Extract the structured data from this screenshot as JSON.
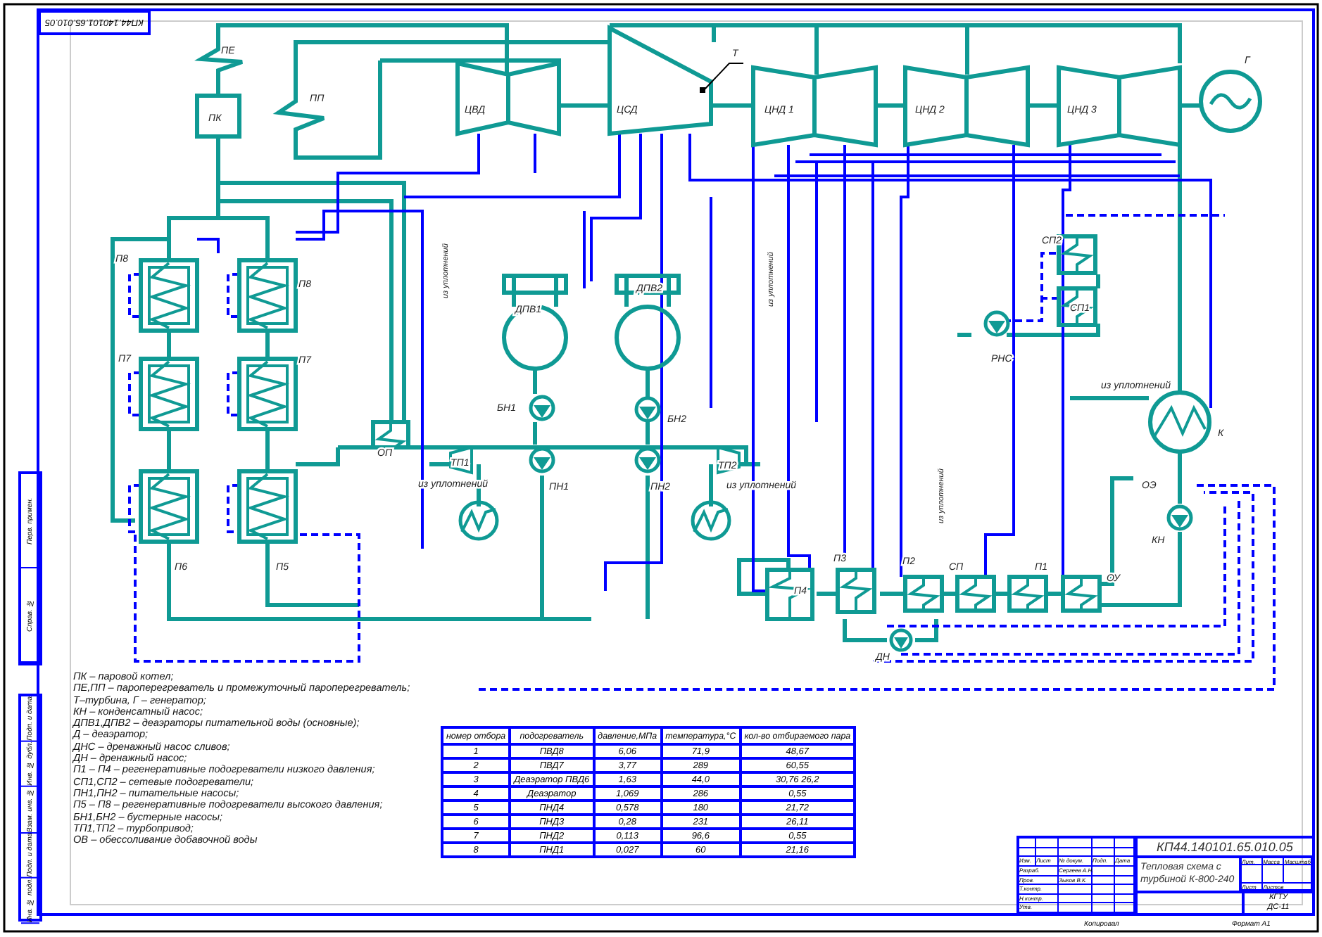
{
  "sheet": {
    "stamp_top": "КП44.140101.65.010.05",
    "side_stamp": [
      "Перв. примен.",
      "Справ. №",
      "Подп. и дата",
      "Инв. № дубл.",
      "Взам. инв. №",
      "Подп. и дата",
      "Инв. № подл."
    ]
  },
  "diagram": {
    "labels": [
      {
        "text": "ПЕ",
        "kind": "horizontal"
      },
      {
        "text": "ПП",
        "kind": "horizontal"
      },
      {
        "text": "ПК",
        "kind": "horizontal"
      },
      {
        "text": "ЦВД",
        "kind": "horizontal"
      },
      {
        "text": "ЦСД",
        "kind": "horizontal"
      },
      {
        "text": "Т",
        "kind": "horizontal"
      },
      {
        "text": "ЦНД 1",
        "kind": "horizontal"
      },
      {
        "text": "ЦНД 2",
        "kind": "horizontal"
      },
      {
        "text": "ЦНД 3",
        "kind": "horizontal"
      },
      {
        "text": "Г",
        "kind": "horizontal"
      },
      {
        "text": "П8",
        "kind": "horizontal"
      },
      {
        "text": "П8",
        "kind": "horizontal"
      },
      {
        "text": "П7",
        "kind": "horizontal"
      },
      {
        "text": "П7",
        "kind": "horizontal"
      },
      {
        "text": "ОП",
        "kind": "horizontal"
      },
      {
        "text": "П6",
        "kind": "horizontal"
      },
      {
        "text": "П5",
        "kind": "horizontal"
      },
      {
        "text": "ДПВ1",
        "kind": "horizontal"
      },
      {
        "text": "ДПВ2",
        "kind": "horizontal"
      },
      {
        "text": "БН1",
        "kind": "horizontal"
      },
      {
        "text": "БН2",
        "kind": "horizontal"
      },
      {
        "text": "ТП1",
        "kind": "horizontal"
      },
      {
        "text": "ТП2",
        "kind": "horizontal"
      },
      {
        "text": "ПН1",
        "kind": "horizontal"
      },
      {
        "text": "ПН2",
        "kind": "horizontal"
      },
      {
        "text": "СП2",
        "kind": "horizontal"
      },
      {
        "text": "СП1",
        "kind": "horizontal"
      },
      {
        "text": "РНС",
        "kind": "horizontal"
      },
      {
        "text": "К",
        "kind": "horizontal"
      },
      {
        "text": "ОЭ",
        "kind": "horizontal"
      },
      {
        "text": "КН",
        "kind": "horizontal"
      },
      {
        "text": "П4",
        "kind": "horizontal"
      },
      {
        "text": "П3",
        "kind": "horizontal"
      },
      {
        "text": "П2",
        "kind": "horizontal"
      },
      {
        "text": "СП",
        "kind": "horizontal"
      },
      {
        "text": "П1",
        "kind": "horizontal"
      },
      {
        "text": "ОУ",
        "kind": "horizontal"
      },
      {
        "text": "ДН",
        "kind": "horizontal"
      },
      {
        "text": "из уплотнений",
        "kind": "vertical"
      },
      {
        "text": "из уплотнений",
        "kind": "vertical"
      },
      {
        "text": "из уплотнений",
        "kind": "vertical"
      },
      {
        "text": "из уплотнений",
        "kind": "horizontal"
      },
      {
        "text": "из уплотнений",
        "kind": "horizontal"
      },
      {
        "text": "из уплотнений",
        "kind": "horizontal"
      }
    ]
  },
  "legend": [
    "ПК – паровой котел;",
    "ПЕ,ПП – пароперегреватель и промежуточный пароперегреватель;",
    "Т–турбина, Г – генератор;",
    "КН – конденсатный насос;",
    "ДПВ1,ДПВ2 – деаэраторы питательной воды (основные);",
    "Д – деаэратор;",
    "ДНС – дренажный насос сливов;",
    "ДН – дренажный насос;",
    "П1 – П4 – регенеративные подогреватели низкого давления;",
    "СП1,СП2 – сетевые подогреватели;",
    "ПН1,ПН2 – питательные насосы;",
    "П5 – П8 – регенеративные подогреватели высокого давления;",
    "БН1,БН2 – бустерные насосы;",
    "ТП1,ТП2 – турбопривод;",
    "ОВ – обессоливание добавочной воды"
  ],
  "table": {
    "columns": [
      "номер отбора",
      "подогреватель",
      "давление,МПа",
      "температура,°С",
      "кол-во отбираемого пара"
    ],
    "rows": [
      [
        "1",
        "ПВД8",
        "6,06",
        "71,9",
        "48,67"
      ],
      [
        "2",
        "ПВД7",
        "3,77",
        "289",
        "60,55"
      ],
      [
        "3",
        "Деаэратор ПВД6",
        "1,63",
        "44,0",
        "30,76 26,2"
      ],
      [
        "4",
        "Деаэратор",
        "1,069",
        "286",
        "0,55"
      ],
      [
        "5",
        "ПНД4",
        "0,578",
        "180",
        "21,72"
      ],
      [
        "6",
        "ПНД3",
        "0,28",
        "231",
        "26,11"
      ],
      [
        "7",
        "ПНД2",
        "0,113",
        "96,6",
        "0,55"
      ],
      [
        "8",
        "ПНД1",
        "0,027",
        "60",
        "21,16"
      ]
    ]
  },
  "title_block": {
    "code": "КП44.140101.65.010.05",
    "title": "Тепловая схема с турбиной К-800-240",
    "header": [
      "Изм.",
      "Лист",
      "№ докум.",
      "Подп.",
      "Дата"
    ],
    "people": [
      {
        "role": "Разраб.",
        "name": "Сергеев А.Н."
      },
      {
        "role": "Пров.",
        "name": "Зыков В.К."
      },
      {
        "role": "Т.контр."
      },
      {
        "role": "Н.контр."
      },
      {
        "role": "Утв."
      }
    ],
    "columns": [
      "Лит.",
      "Масса",
      "Масштаб"
    ],
    "sheet_label": "Лист",
    "sheets_label": "Листов",
    "org": "КГТУ",
    "group": "ДС-11",
    "copied": "Копировал",
    "format": "Формат А1"
  }
}
